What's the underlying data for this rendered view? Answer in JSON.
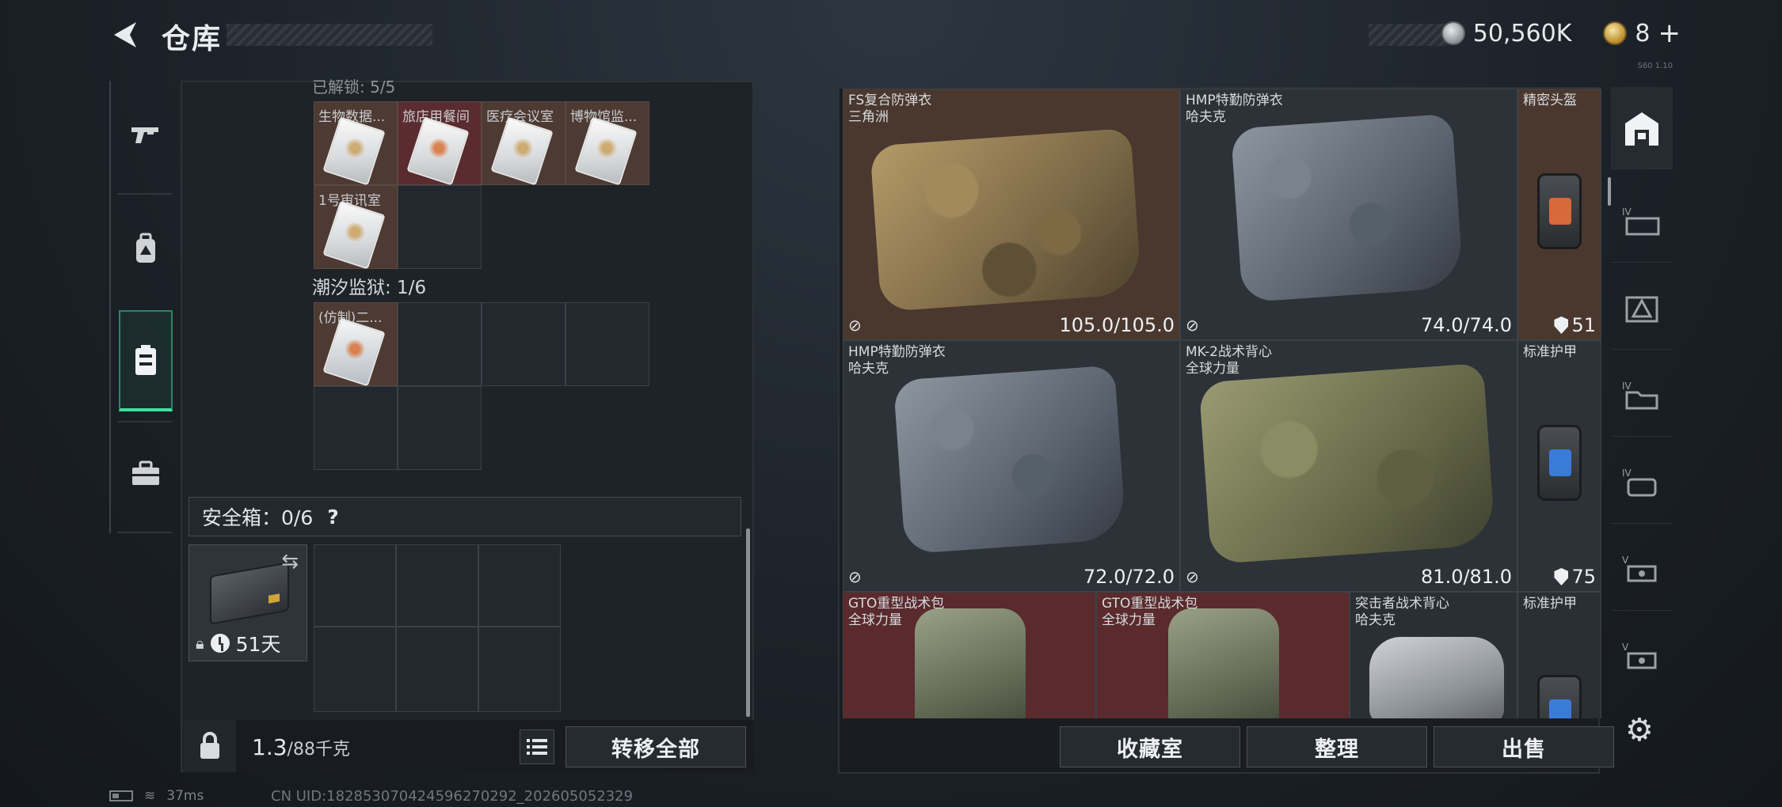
{
  "header": {
    "title": "仓库",
    "silver_amount": "50,560K",
    "gold_amount": "8",
    "gold_plus": "+",
    "version": "S60 1.10"
  },
  "left_sidebar": {
    "tabs": [
      {
        "name": "weapon",
        "icon": "gun-icon"
      },
      {
        "name": "equipment",
        "icon": "backpack-icon"
      },
      {
        "name": "storage",
        "icon": "storage-icon",
        "active": true
      },
      {
        "name": "items",
        "icon": "toolbox-icon"
      }
    ]
  },
  "key_room_grid": {
    "title_partial": "已解锁: 5/5",
    "items": [
      {
        "label": "生物数据...",
        "color": "brown"
      },
      {
        "label": "旅店用餐间",
        "color": "red"
      },
      {
        "label": "医疗会议室",
        "color": "brown"
      },
      {
        "label": "博物馆监...",
        "color": "brown"
      },
      {
        "label": "1号审讯室",
        "color": "brown"
      }
    ]
  },
  "tide_prison": {
    "title": "潮汐监狱: 1/6",
    "items": [
      {
        "label": "(仿制)二...",
        "color": "brown"
      }
    ]
  },
  "safe_box": {
    "label": "安全箱：0/6",
    "help": "?",
    "days": "51天"
  },
  "weight": {
    "current": "1.3",
    "max": "/88千克"
  },
  "buttons": {
    "transfer_all": "转移全部",
    "collection": "收藏室",
    "organize": "整理",
    "sell": "出售"
  },
  "right_items": [
    {
      "name": "FS复合防弹衣",
      "maker": "三角洲",
      "durability": "105.0/105.0",
      "color": "brown",
      "shape": "vest-camo"
    },
    {
      "name": "HMP特勤防弹衣",
      "maker": "哈夫克",
      "durability": "74.0/74.0",
      "color": "slate",
      "shape": "vest-gray"
    },
    {
      "name": "精密头盔",
      "maker": "",
      "armor": "51",
      "color": "brown",
      "shape": "plate-orange"
    },
    {
      "name": "HMP特勤防弹衣",
      "maker": "哈夫克",
      "durability": "72.0/72.0",
      "color": "slate",
      "shape": "vest-gray"
    },
    {
      "name": "MK-2战术背心",
      "maker": "全球力量",
      "durability": "81.0/81.0",
      "color": "slate",
      "shape": "vest-olive"
    },
    {
      "name": "标准护甲",
      "maker": "",
      "armor": "75",
      "color": "slate",
      "shape": "plate-blue"
    },
    {
      "name": "GTO重型战术包",
      "maker": "全球力量",
      "color": "red",
      "shape": "pack"
    },
    {
      "name": "GTO重型战术包",
      "maker": "全球力量",
      "color": "red",
      "shape": "pack"
    },
    {
      "name": "突击者战术背心",
      "maker": "哈夫克",
      "color": "gray",
      "shape": "pack-white"
    },
    {
      "name": "标准护甲",
      "maker": "",
      "color": "gray",
      "shape": "plate-blue"
    }
  ],
  "status_bar": {
    "ping": "37ms",
    "uid": "CN UID:182853070424596270292_202605052329"
  },
  "colors": {
    "accent": "#3ee0a0",
    "brown_tile": "#4a382f",
    "red_tile": "#5a2a2d",
    "slate_tile": "#2c3237"
  }
}
